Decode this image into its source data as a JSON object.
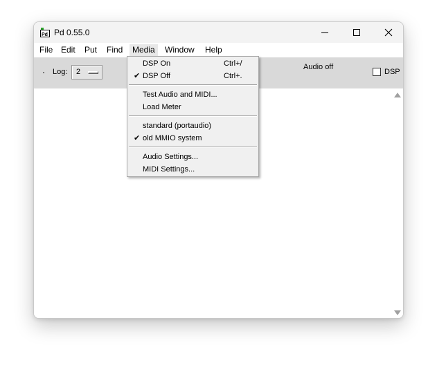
{
  "window": {
    "title": "Pd 0.55.0",
    "icon": "pd-app-icon"
  },
  "menubar": {
    "items": [
      "File",
      "Edit",
      "Put",
      "Find",
      "Media",
      "Window",
      "Help"
    ],
    "active": "Media"
  },
  "toolbar": {
    "log_label": "Log:",
    "log_value": "2",
    "audio_status": "Audio off",
    "dsp_label": "DSP",
    "dsp_checked": false
  },
  "media_menu": {
    "items": [
      {
        "label": "DSP On",
        "shortcut": "Ctrl+/",
        "checked": false
      },
      {
        "label": "DSP Off",
        "shortcut": "Ctrl+.",
        "checked": true
      },
      {
        "label": "Test Audio and MIDI...",
        "shortcut": "",
        "checked": false
      },
      {
        "label": "Load Meter",
        "shortcut": "",
        "checked": false
      },
      {
        "label": "standard (portaudio)",
        "shortcut": "",
        "checked": false
      },
      {
        "label": "old MMIO system",
        "shortcut": "",
        "checked": true
      },
      {
        "label": "Audio Settings...",
        "shortcut": "",
        "checked": false
      },
      {
        "label": "MIDI Settings...",
        "shortcut": "",
        "checked": false
      }
    ],
    "check_glyph": "✔"
  },
  "colors": {
    "toolbar_bg": "#d9d9d9",
    "menu_bg": "#f0f0f0",
    "titlebar_bg": "#f3f3f3"
  }
}
